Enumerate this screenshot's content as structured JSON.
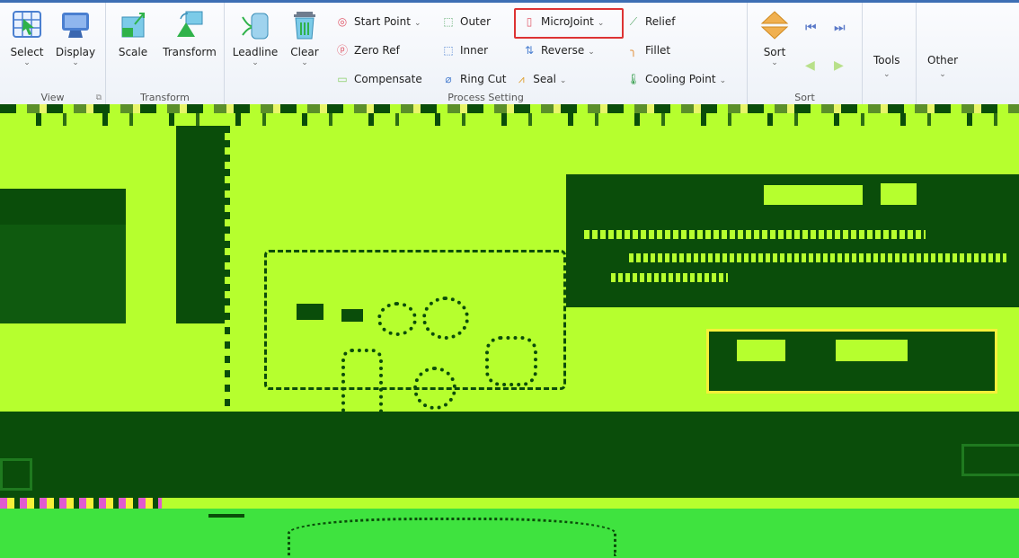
{
  "ribbon": {
    "view": {
      "label": "View",
      "select": "Select",
      "display": "Display"
    },
    "transform": {
      "label": "Transform",
      "scale": "Scale",
      "transform": "Transform"
    },
    "process": {
      "label": "Process Setting",
      "leadline": "Leadline",
      "clear": "Clear",
      "start_point": "Start Point",
      "zero_ref": "Zero Ref",
      "compensate": "Compensate",
      "outer": "Outer",
      "inner": "Inner",
      "ring_cut": "Ring Cut",
      "seal": "Seal",
      "microjoint": "MicroJoint",
      "reverse": "Reverse",
      "relief": "Relief",
      "fillet": "Fillet",
      "cooling_point": "Cooling Point"
    },
    "sort": {
      "label": "Sort",
      "sort": "Sort"
    },
    "tools": "Tools",
    "other": "Other"
  },
  "colors": {
    "accent": "#3d6fb4",
    "highlight": "#dd3333",
    "canvas_lime": "#b6ff2e",
    "canvas_dark": "#0a4d0a",
    "canvas_green": "#3fe33f"
  },
  "icons": {
    "select": "select-grid-icon",
    "display": "monitor-icon",
    "scale": "scale-icon",
    "transform": "transform-icon",
    "leadline": "leadline-icon",
    "clear": "trash-icon",
    "sort": "sort-arrows-icon"
  }
}
